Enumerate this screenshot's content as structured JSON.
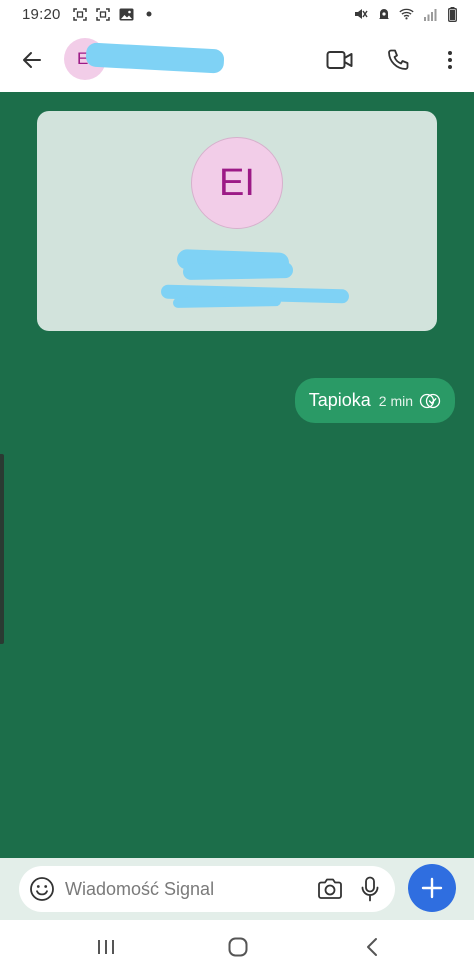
{
  "status_bar": {
    "time": "19:20"
  },
  "header": {
    "avatar_initials": "EI"
  },
  "contact_card": {
    "avatar_initials": "EI"
  },
  "messages": [
    {
      "text": "Tapioka",
      "time": "2 min",
      "status": "read",
      "direction": "outgoing"
    }
  ],
  "composer": {
    "placeholder": "Wiadomość Signal"
  },
  "icons": {
    "back": "arrow-left-icon",
    "video": "video-camera-icon",
    "call": "phone-icon",
    "more": "more-vertical-icon",
    "emoji": "smiley-icon",
    "camera": "camera-icon",
    "mic": "microphone-icon",
    "attach": "plus-icon"
  },
  "colors": {
    "chat_background": "#1c6e4a",
    "outgoing_bubble": "#2a9a66",
    "contact_card": "#d2e3dc",
    "avatar_background": "#f2cde8",
    "avatar_text": "#9c1a86",
    "attach_button": "#2f6ee0",
    "composer_bar": "#e3eee9",
    "redaction": "#7fd2f5"
  }
}
